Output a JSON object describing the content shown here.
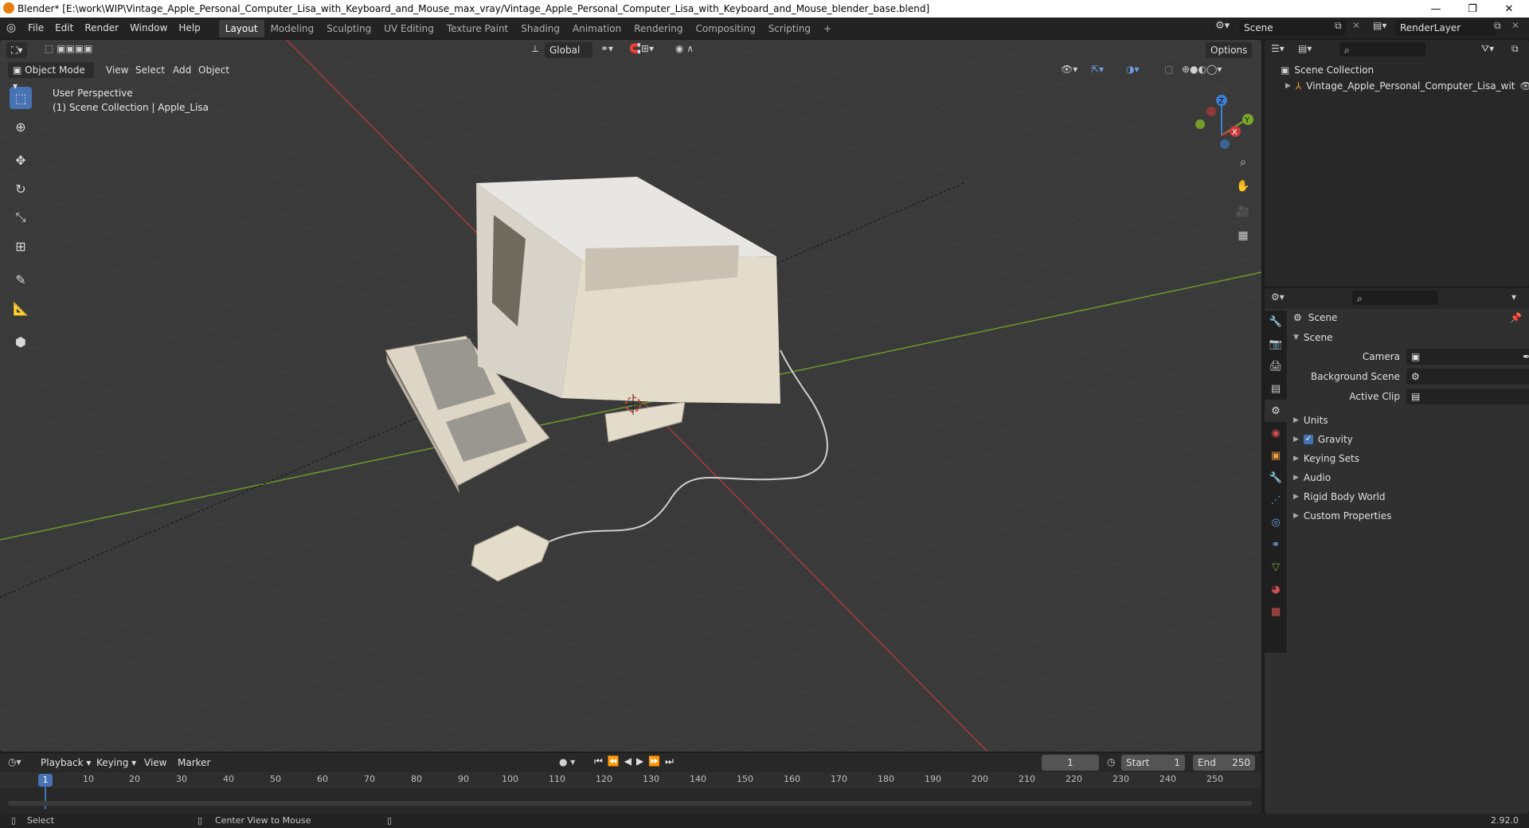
{
  "window": {
    "title": "Blender* [E:\\work\\WIP\\Vintage_Apple_Personal_Computer_Lisa_with_Keyboard_and_Mouse_max_vray/Vintage_Apple_Personal_Computer_Lisa_with_Keyboard_and_Mouse_blender_base.blend]",
    "minimize": "—",
    "maximize": "❐",
    "close": "✕"
  },
  "menubar": {
    "items": [
      "File",
      "Edit",
      "Render",
      "Window",
      "Help"
    ]
  },
  "workspaces": [
    "Layout",
    "Modeling",
    "Sculpting",
    "UV Editing",
    "Texture Paint",
    "Shading",
    "Animation",
    "Rendering",
    "Compositing",
    "Scripting"
  ],
  "add_workspace": "+",
  "scene_field": "Scene",
  "renderlayer_field": "RenderLayer",
  "viewport": {
    "mode": "Object Mode",
    "menus": [
      "View",
      "Select",
      "Add",
      "Object"
    ],
    "orientation": "Global",
    "options": "Options",
    "overlay_line1": "User Perspective",
    "overlay_line2": "(1) Scene Collection | Apple_Lisa",
    "gizmo_axes": [
      "Z",
      "Y",
      "X"
    ]
  },
  "outliner": {
    "root": "Scene Collection",
    "items": [
      "Vintage_Apple_Personal_Computer_Lisa_wit"
    ]
  },
  "properties": {
    "context": "Scene",
    "panel": "Scene",
    "fields": [
      {
        "label": "Camera",
        "value": ""
      },
      {
        "label": "Background Scene",
        "value": ""
      },
      {
        "label": "Active Clip",
        "value": ""
      }
    ],
    "subpanels": [
      "Units",
      "Gravity",
      "Keying Sets",
      "Audio",
      "Rigid Body World",
      "Custom Properties"
    ],
    "gravity_checked": true
  },
  "timeline": {
    "menus": [
      "Playback",
      "Keying",
      "View",
      "Marker"
    ],
    "current_frame": "1",
    "start_label": "Start",
    "start": "1",
    "end_label": "End",
    "end": "250",
    "ruler": [
      "1",
      "10",
      "20",
      "30",
      "40",
      "50",
      "60",
      "70",
      "80",
      "90",
      "100",
      "110",
      "120",
      "130",
      "140",
      "150",
      "160",
      "170",
      "180",
      "190",
      "200",
      "210",
      "220",
      "230",
      "240",
      "250"
    ]
  },
  "statusbar": {
    "left": "Select",
    "middle": "Center View to Mouse",
    "version": "2.92.0"
  },
  "colors": {
    "accent": "#4772b3",
    "x_axis": "#c83a3a",
    "y_axis": "#7aa82a",
    "z_axis": "#3e7fd6",
    "model": "#e3dccb"
  }
}
